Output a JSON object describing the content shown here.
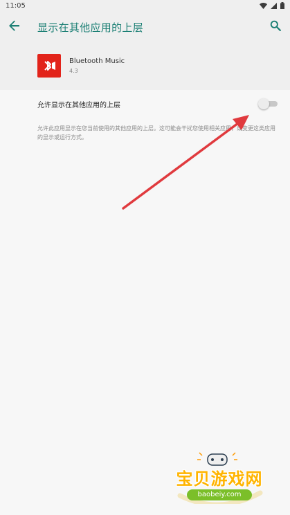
{
  "status_bar": {
    "time": "11:05",
    "icons": [
      "wifi-icon",
      "signal-icon",
      "battery-icon"
    ]
  },
  "toolbar": {
    "title": "显示在其他应用的上层",
    "back_icon": "arrow-back-icon",
    "search_icon": "search-icon",
    "accent_color": "#1b7f74"
  },
  "app": {
    "name": "Bluetooth Music",
    "version": "4.3",
    "icon": "bluetooth-music-app-icon",
    "icon_color": "#e2231a"
  },
  "setting": {
    "label": "允许显示在其他应用的上层",
    "enabled": false,
    "description": "允许此应用显示在您当前使用的其他应用的上层。这可能会干扰您使用相关应用，或变更这类应用的显示或运行方式。"
  },
  "annotation": {
    "arrow_color": "#e03a3e"
  },
  "watermark": {
    "text": "宝贝游戏网",
    "domain": "baobeiy.com"
  }
}
